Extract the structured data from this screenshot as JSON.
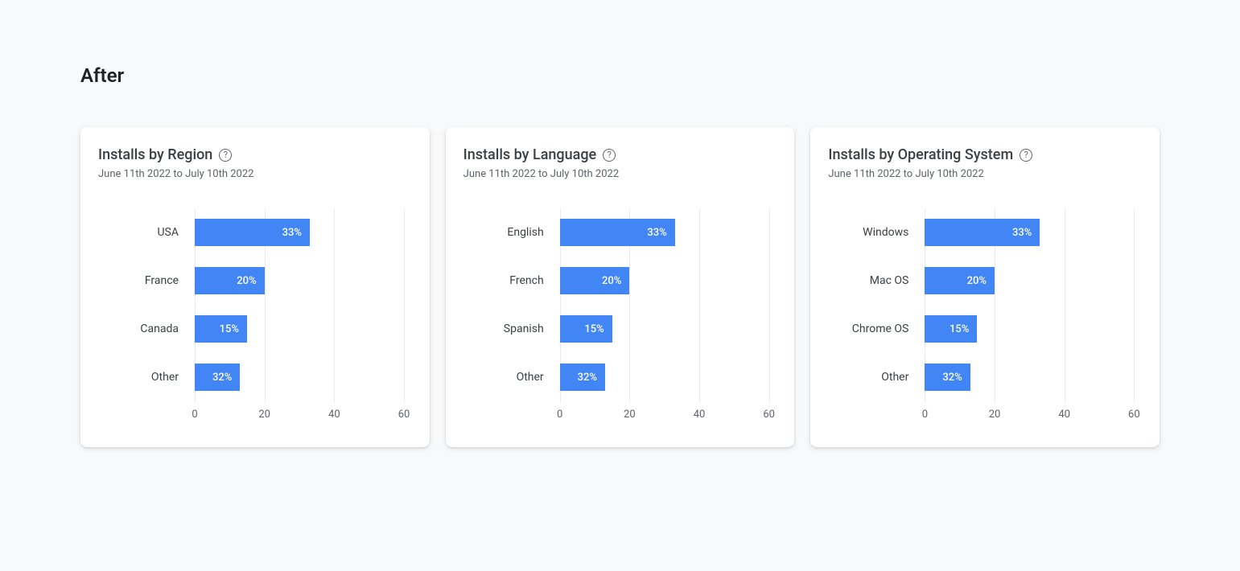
{
  "page_title": "After",
  "date_range": "June 11th 2022 to July 10th 2022",
  "axis": {
    "min": 0,
    "max": 60,
    "ticks": [
      0,
      20,
      40,
      60
    ]
  },
  "charts": [
    {
      "title": "Installs by Region",
      "data": [
        {
          "label": "USA",
          "value": 33,
          "text": "33%"
        },
        {
          "label": "France",
          "value": 20,
          "text": "20%"
        },
        {
          "label": "Canada",
          "value": 15,
          "text": "15%"
        },
        {
          "label": "Other",
          "value": 13,
          "text": "32%"
        }
      ]
    },
    {
      "title": "Installs by Language",
      "data": [
        {
          "label": "English",
          "value": 33,
          "text": "33%"
        },
        {
          "label": "French",
          "value": 20,
          "text": "20%"
        },
        {
          "label": "Spanish",
          "value": 15,
          "text": "15%"
        },
        {
          "label": "Other",
          "value": 13,
          "text": "32%"
        }
      ]
    },
    {
      "title": "Installs by Operating System",
      "data": [
        {
          "label": "Windows",
          "value": 33,
          "text": "33%"
        },
        {
          "label": "Mac OS",
          "value": 20,
          "text": "20%"
        },
        {
          "label": "Chrome OS",
          "value": 15,
          "text": "15%"
        },
        {
          "label": "Other",
          "value": 13,
          "text": "32%"
        }
      ]
    }
  ],
  "chart_data": [
    {
      "type": "bar",
      "orientation": "horizontal",
      "title": "Installs by Region",
      "subtitle": "June 11th 2022 to July 10th 2022",
      "categories": [
        "USA",
        "France",
        "Canada",
        "Other"
      ],
      "values": [
        33,
        20,
        15,
        32
      ],
      "value_labels": [
        "33%",
        "20%",
        "15%",
        "32%"
      ],
      "xlabel": "",
      "ylabel": "",
      "xlim": [
        0,
        60
      ],
      "xticks": [
        0,
        20,
        40,
        60
      ]
    },
    {
      "type": "bar",
      "orientation": "horizontal",
      "title": "Installs by Language",
      "subtitle": "June 11th 2022 to July 10th 2022",
      "categories": [
        "English",
        "French",
        "Spanish",
        "Other"
      ],
      "values": [
        33,
        20,
        15,
        32
      ],
      "value_labels": [
        "33%",
        "20%",
        "15%",
        "32%"
      ],
      "xlabel": "",
      "ylabel": "",
      "xlim": [
        0,
        60
      ],
      "xticks": [
        0,
        20,
        40,
        60
      ]
    },
    {
      "type": "bar",
      "orientation": "horizontal",
      "title": "Installs by Operating System",
      "subtitle": "June 11th 2022 to July 10th 2022",
      "categories": [
        "Windows",
        "Mac OS",
        "Chrome OS",
        "Other"
      ],
      "values": [
        33,
        20,
        15,
        32
      ],
      "value_labels": [
        "33%",
        "20%",
        "15%",
        "32%"
      ],
      "xlabel": "",
      "ylabel": "",
      "xlim": [
        0,
        60
      ],
      "xticks": [
        0,
        20,
        40,
        60
      ]
    }
  ]
}
